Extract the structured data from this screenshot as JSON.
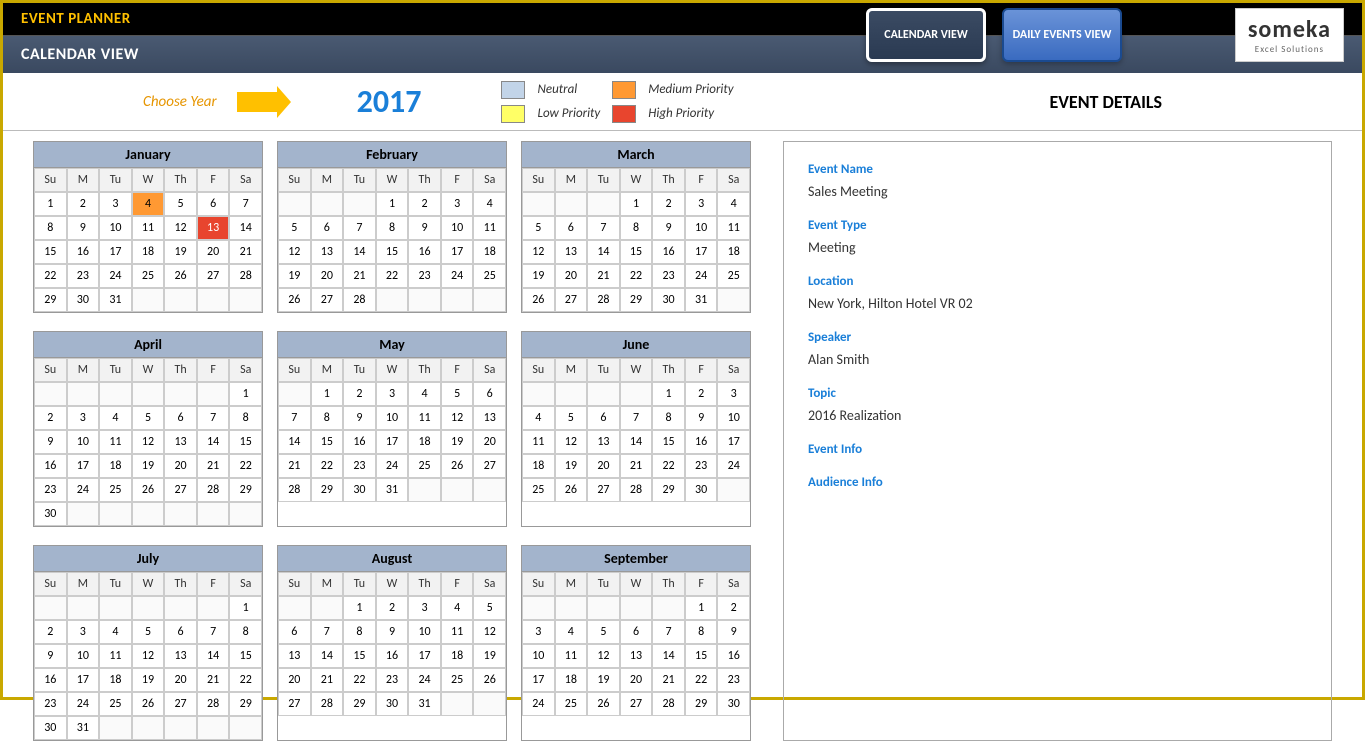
{
  "header": {
    "title": "EVENT PLANNER",
    "subtitle": "CALENDAR VIEW"
  },
  "buttons": {
    "calendar": "CALENDAR VIEW",
    "daily": "DAILY EVENTS VIEW"
  },
  "logo": {
    "main": "someka",
    "sub": "Excel Solutions"
  },
  "toolbar": {
    "choose_label": "Choose Year",
    "year": "2017",
    "legend": {
      "neutral": "Neutral",
      "low": "Low Priority",
      "medium": "Medium Priority",
      "high": "High Priority"
    }
  },
  "details_title": "EVENT DETAILS",
  "day_headers": [
    "Su",
    "M",
    "Tu",
    "W",
    "Th",
    "F",
    "Sa"
  ],
  "months": [
    {
      "name": "January",
      "start": 0,
      "days": 31,
      "marks": {
        "4": "med",
        "13": "high"
      }
    },
    {
      "name": "February",
      "start": 3,
      "days": 28,
      "marks": {}
    },
    {
      "name": "March",
      "start": 3,
      "days": 31,
      "marks": {}
    },
    {
      "name": "April",
      "start": 6,
      "days": 30,
      "marks": {}
    },
    {
      "name": "May",
      "start": 1,
      "days": 31,
      "marks": {}
    },
    {
      "name": "June",
      "start": 4,
      "days": 30,
      "marks": {}
    },
    {
      "name": "July",
      "start": 6,
      "days": 31,
      "marks": {}
    },
    {
      "name": "August",
      "start": 2,
      "days": 31,
      "marks": {}
    },
    {
      "name": "September",
      "start": 5,
      "days": 30,
      "marks": {}
    }
  ],
  "details": {
    "event_name_label": "Event Name",
    "event_name": "Sales Meeting",
    "event_type_label": "Event Type",
    "event_type": "Meeting",
    "location_label": "Location",
    "location": "New York, Hilton Hotel VR 02",
    "speaker_label": "Speaker",
    "speaker": "Alan Smith",
    "topic_label": "Topic",
    "topic": "2016 Realization",
    "event_info_label": "Event Info",
    "event_info": "",
    "audience_label": "Audience Info",
    "audience": ""
  }
}
